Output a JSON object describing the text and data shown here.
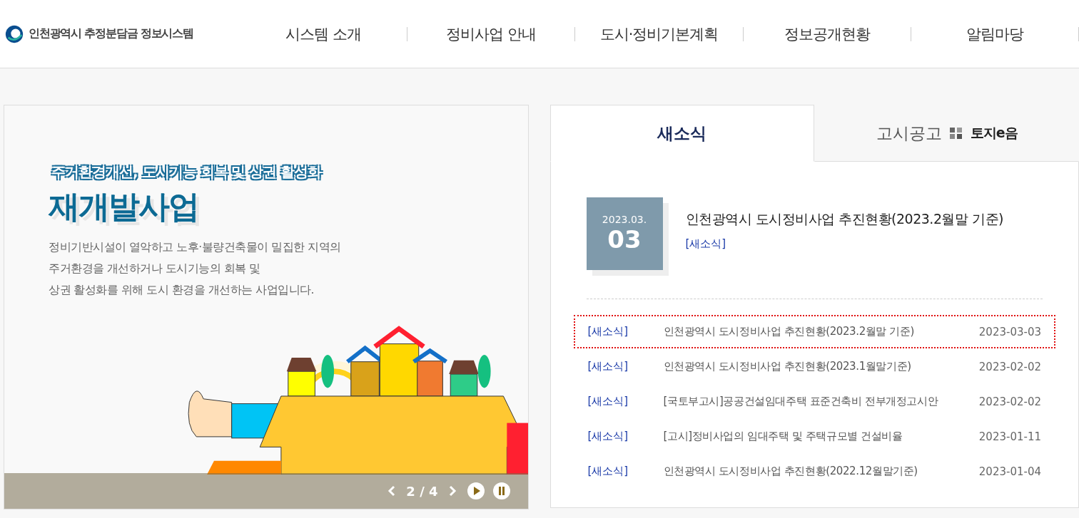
{
  "header": {
    "logo_text": "인천광역시 추정분담금 정보시스템",
    "nav": [
      "시스템 소개",
      "정비사업 안내",
      "도시·정비기본계획",
      "정보공개현황",
      "알림마당"
    ]
  },
  "banner": {
    "subtitle": "주거환경개선, 도시기능 회복 및 상권 활성화",
    "title": "재개발사업",
    "description": [
      "정비기반시설이 열악하고 노후·불량건축물이 밀집한 지역의",
      "주거환경을 개선하거나 도시기능의 회복 및",
      "상권 활성화를 위해 도시 환경을 개선하는 사업입니다."
    ],
    "pager": "2 / 4"
  },
  "news": {
    "tabs": [
      {
        "label": "새소식",
        "selected": true
      },
      {
        "label": "고시공고",
        "selected": false,
        "logo_text": "토지e음"
      }
    ],
    "featured": {
      "month": "2023.03.",
      "day": "03",
      "title": "인천광역시 도시정비사업 추진현황(2023.2월말 기준)",
      "tag": "[새소식]"
    },
    "rows": [
      {
        "tag": "[새소식]",
        "title": "인천광역시 도시정비사업 추진현황(2023.2월말 기준)",
        "date": "2023-03-03",
        "focused": true
      },
      {
        "tag": "[새소식]",
        "title": "인천광역시 도시정비사업 추진현황(2023.1월말기준)",
        "date": "2023-02-02",
        "focused": false
      },
      {
        "tag": "[새소식]",
        "title": "[국토부고시]공공건설임대주택 표준건축비 전부개정고시안",
        "date": "2023-02-02",
        "focused": false
      },
      {
        "tag": "[새소식]",
        "title": "[고시]정비사업의 임대주택 및 주택규모별 건설비율",
        "date": "2023-01-11",
        "focused": false
      },
      {
        "tag": "[새소식]",
        "title": "인천광역시 도시정비사업 추진현황(2022.12월말기준)",
        "date": "2023-01-04",
        "focused": false
      }
    ]
  }
}
